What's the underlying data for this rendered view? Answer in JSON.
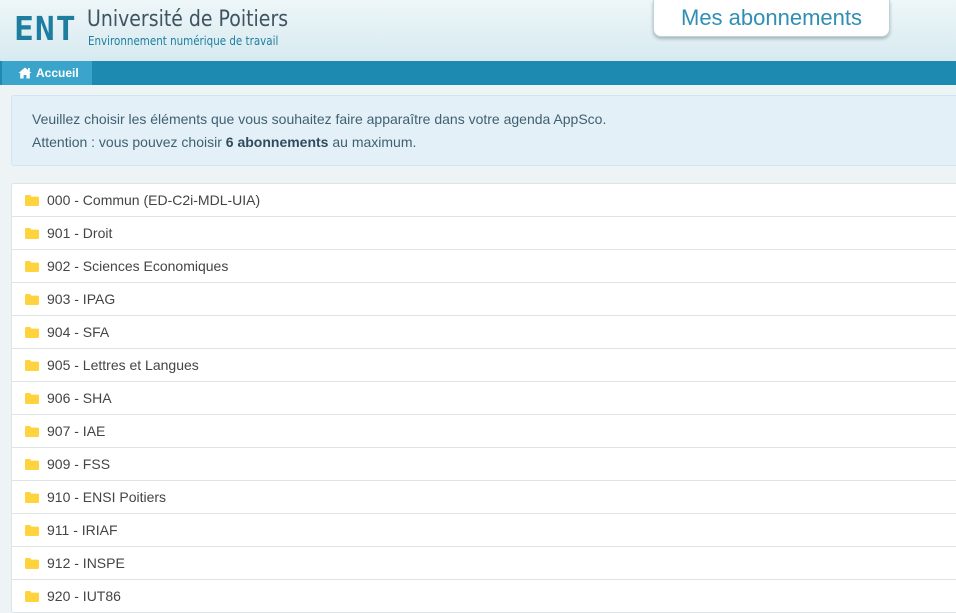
{
  "header": {
    "logo_ent": "ENT",
    "logo_university": "Université de Poitiers",
    "logo_subtitle": "Environnement numérique de travail",
    "subscriptions_button": "Mes abonnements"
  },
  "nav": {
    "home_label": "Accueil",
    "home_icon": "home-icon"
  },
  "info": {
    "line1": "Veuillez choisir les éléments que vous souhaitez faire apparaître dans votre agenda AppSco.",
    "line2_prefix": "Attention : vous pouvez choisir ",
    "line2_bold": "6 abonnements",
    "line2_suffix": " au maximum."
  },
  "colors": {
    "folder": "#ffd33d",
    "accent": "#1c8ab1",
    "nav_active": "#3ba4cb"
  },
  "list": {
    "icon": "folder-icon",
    "items": [
      "000 - Commun (ED-C2i-MDL-UIA)",
      "901 - Droit",
      "902 - Sciences Economiques",
      "903 - IPAG",
      "904 - SFA",
      "905 - Lettres et Langues",
      "906 - SHA",
      "907 - IAE",
      "909 - FSS",
      "910 - ENSI Poitiers",
      "911 - IRIAF",
      "912 - INSPE",
      "920 - IUT86"
    ]
  }
}
